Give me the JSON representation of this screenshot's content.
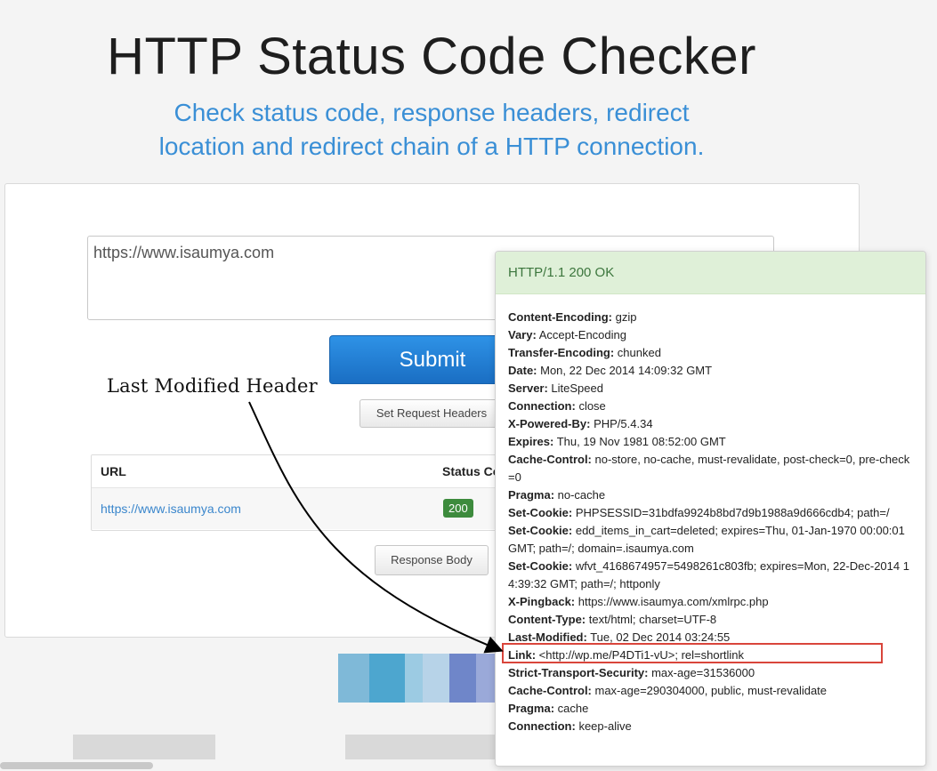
{
  "page": {
    "title": "HTTP Status Code Checker",
    "subtitle_line1": "Check status code, response headers, redirect",
    "subtitle_line2": "location and redirect chain of a HTTP connection."
  },
  "form": {
    "url_value": "https://www.isaumya.com",
    "submit_label": "Submit",
    "set_headers_label": "Set Request Headers",
    "response_body_label": "Response Body"
  },
  "results": {
    "columns": [
      "URL",
      "Status Co"
    ],
    "rows": [
      {
        "url": "https://www.isaumya.com",
        "status": "200"
      }
    ]
  },
  "annotation": {
    "text": "Last Modified Header"
  },
  "popover": {
    "status_line": "HTTP/1.1 200 OK",
    "headers": [
      {
        "name": "Content-Encoding:",
        "value": " gzip"
      },
      {
        "name": "Vary:",
        "value": " Accept-Encoding"
      },
      {
        "name": "Transfer-Encoding:",
        "value": " chunked"
      },
      {
        "name": "Date:",
        "value": " Mon, 22 Dec 2014 14:09:32 GMT"
      },
      {
        "name": "Server:",
        "value": " LiteSpeed"
      },
      {
        "name": "Connection:",
        "value": " close"
      },
      {
        "name": "X-Powered-By:",
        "value": " PHP/5.4.34"
      },
      {
        "name": "Expires:",
        "value": " Thu, 19 Nov 1981 08:52:00 GMT"
      },
      {
        "name": "Cache-Control:",
        "value": " no-store, no-cache, must-revalidate, post-check=0, pre-check=0"
      },
      {
        "name": "Pragma:",
        "value": " no-cache"
      },
      {
        "name": "Set-Cookie:",
        "value": " PHPSESSID=31bdfa9924b8bd7d9b1988a9d666cdb4; path=/"
      },
      {
        "name": "Set-Cookie:",
        "value": " edd_items_in_cart=deleted; expires=Thu, 01-Jan-1970 00:00:01 GMT; path=/; domain=.isaumya.com"
      },
      {
        "name": "Set-Cookie:",
        "value": " wfvt_4168674957=5498261c803fb; expires=Mon, 22-Dec-2014 14:39:32 GMT; path=/; httponly"
      },
      {
        "name": "X-Pingback:",
        "value": " https://www.isaumya.com/xmlrpc.php"
      },
      {
        "name": "Content-Type:",
        "value": " text/html; charset=UTF-8"
      },
      {
        "name": "Last-Modified:",
        "value": " Tue, 02 Dec 2014 03:24:55"
      },
      {
        "name": "Link:",
        "value": " <http://wp.me/P4DTi1-vU>; rel=shortlink"
      },
      {
        "name": "Strict-Transport-Security:",
        "value": " max-age=31536000"
      },
      {
        "name": "Cache-Control:",
        "value": " max-age=290304000, public, must-revalidate"
      },
      {
        "name": "Pragma:",
        "value": " cache"
      },
      {
        "name": "Connection:",
        "value": " keep-alive"
      }
    ]
  },
  "colors": {
    "accent_blue": "#3a8fd6",
    "success_green": "#3d8b3d",
    "popover_header_bg": "#dff0d8",
    "highlight_red": "#d9453b"
  }
}
